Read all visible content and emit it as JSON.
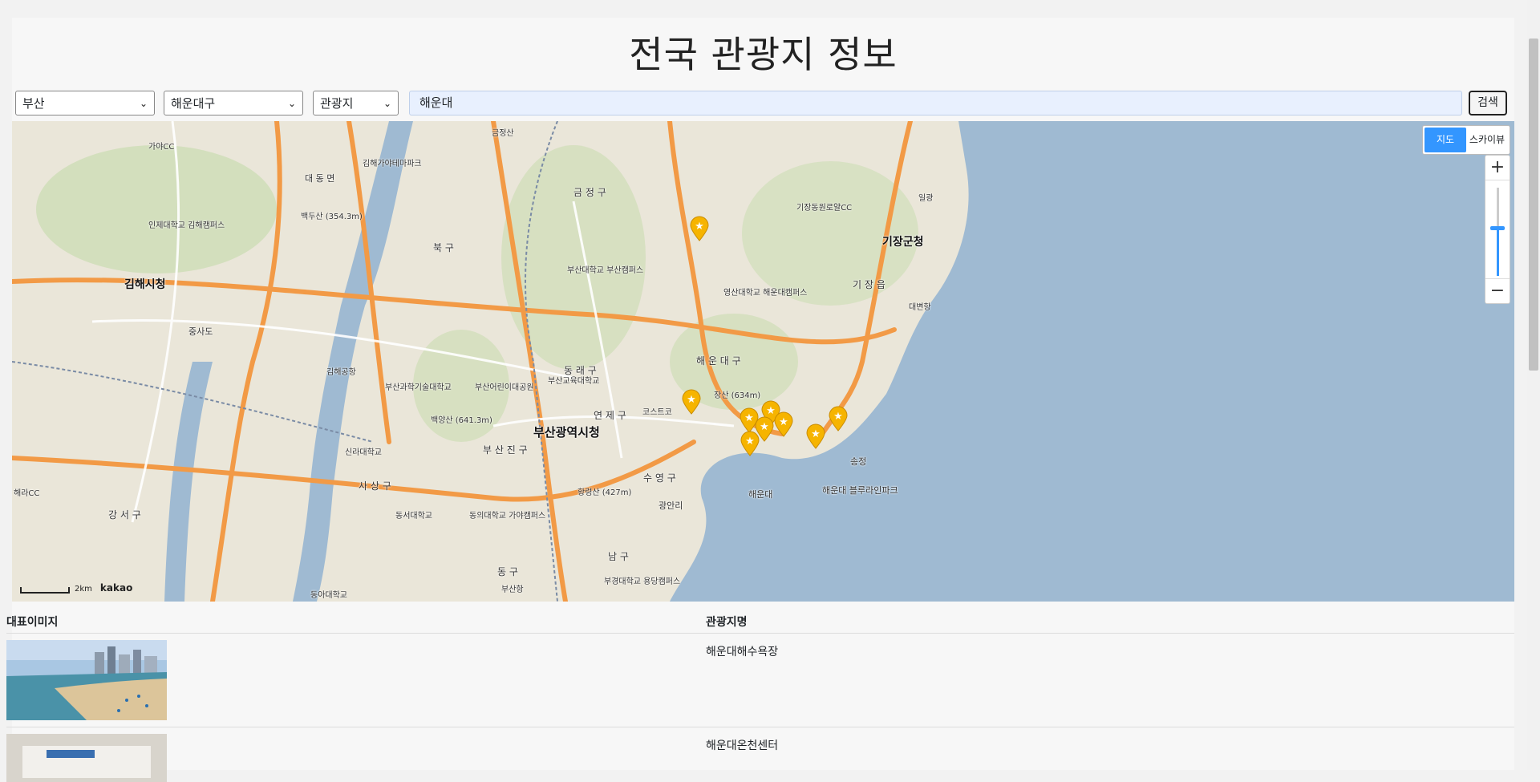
{
  "page_title": "전국 관광지 정보",
  "filters": {
    "region_selected": "부산",
    "district_selected": "해운대구",
    "category_selected": "관광지"
  },
  "search": {
    "value": "해운대",
    "button_label": "검색"
  },
  "map": {
    "maptype_map": "지도",
    "maptype_skyview": "스카이뷰",
    "zoom_in": "+",
    "zoom_out": "−",
    "zoom_level_fraction": 0.55,
    "scale_label": "2km",
    "provider_logo": "kakao",
    "colors": {
      "sea": "#9fbad2",
      "land": "#eae6d9",
      "green": "#c9dcb0",
      "road_major": "#f29a46",
      "road_minor": "#ffffff",
      "marker": "#f6b400",
      "accent": "#3396ff"
    },
    "labels": [
      "김해시청",
      "부산광역시청",
      "기장군청",
      "해운대",
      "송정",
      "해운대 블루라인파크",
      "북 구",
      "금 정 구",
      "동 래 구",
      "연 제 구",
      "수 영 구",
      "부 산 진 구",
      "사 상 구",
      "강 서 구",
      "남 구",
      "동 구",
      "해 운 대 구",
      "기 장 읍",
      "장산 (634m)",
      "백양산 (641.3m)",
      "황령산 (427m)",
      "백두산 (354.3m)",
      "금정산",
      "광안리",
      "부산항",
      "대변항",
      "일광",
      "김해공항",
      "부산대학교 부산캠퍼스",
      "영산대학교 해운대캠퍼스",
      "인제대학교 김해캠퍼스",
      "부산교육대학교",
      "신라대학교",
      "동서대학교",
      "동의대학교 가야캠퍼스",
      "부경대학교 용당캠퍼스",
      "동아대학교",
      "부산과학기술대학교",
      "부산어린이대공원",
      "김해가야테마파크",
      "기장동원로얄CC",
      "가야CC",
      "해라CC",
      "코스트코",
      "대 동 면",
      "중사도"
    ],
    "marker_count": 9
  },
  "table": {
    "col_image": "대표이미지",
    "col_name": "관광지명",
    "rows": [
      {
        "name": "해운대해수욕장"
      },
      {
        "name": "해운대온천센터"
      }
    ]
  }
}
